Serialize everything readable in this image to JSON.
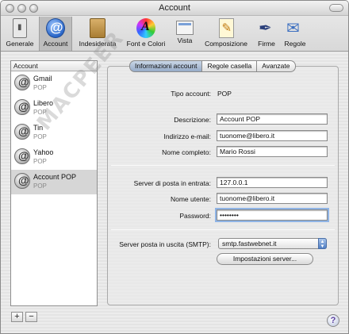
{
  "window": {
    "title": "Account"
  },
  "toolbar": {
    "items": [
      {
        "label": "Generale",
        "icon": "general-icon"
      },
      {
        "label": "Account",
        "icon": "account-icon"
      },
      {
        "label": "Indesiderata",
        "icon": "junk-icon"
      },
      {
        "label": "Font e Colori",
        "icon": "fonts-colors-icon"
      },
      {
        "label": "Vista",
        "icon": "view-icon"
      },
      {
        "label": "Composizione",
        "icon": "compose-icon"
      },
      {
        "label": "Firme",
        "icon": "signatures-icon"
      },
      {
        "label": "Regole",
        "icon": "rules-icon"
      }
    ],
    "active": "Account"
  },
  "accounts": {
    "header": "Account",
    "items": [
      {
        "name": "Gmail",
        "type": "POP"
      },
      {
        "name": "Libero",
        "type": "POP"
      },
      {
        "name": "Tin",
        "type": "POP"
      },
      {
        "name": "Yahoo",
        "type": "POP"
      },
      {
        "name": "Account POP",
        "type": "POP"
      }
    ],
    "selected": "Account POP",
    "add_label": "+",
    "remove_label": "−"
  },
  "tabs": {
    "items": [
      "Informazioni account",
      "Regole casella",
      "Avanzate"
    ],
    "active": "Informazioni account"
  },
  "form": {
    "account_type_label": "Tipo account:",
    "account_type_value": "POP",
    "description_label": "Descrizione:",
    "description_value": "Account POP",
    "email_label": "Indirizzo e-mail:",
    "email_value": "tuonome@libero.it",
    "fullname_label": "Nome completo:",
    "fullname_value": "Mario Rossi",
    "incoming_label": "Server di posta in entrata:",
    "incoming_value": "127.0.0.1",
    "username_label": "Nome utente:",
    "username_value": "tuonome@libero.it",
    "password_label": "Password:",
    "password_value": "••••••••",
    "smtp_label": "Server posta in uscita (SMTP):",
    "smtp_value": "smtp.fastwebnet.it",
    "server_settings_button": "Impostazioni server..."
  },
  "help": {
    "label": "?"
  },
  "watermark": {
    "text": "MACPEER"
  }
}
